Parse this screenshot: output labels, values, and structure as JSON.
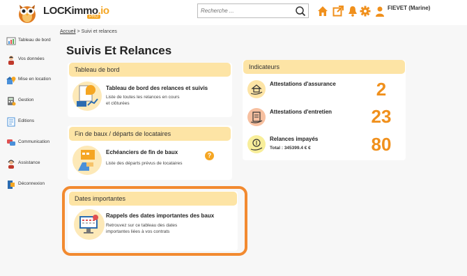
{
  "app": {
    "logo_text": "LOCKimmo",
    "logo_suffix": ".io",
    "logo_badge": "PRO"
  },
  "search": {
    "placeholder": "Recherche ..."
  },
  "user": {
    "name": "FIEVET (Marine)"
  },
  "top_icons": [
    "home-icon",
    "external-link-icon",
    "bell-icon",
    "gear-icon",
    "user-icon"
  ],
  "sidebar": {
    "items": [
      {
        "label": "Tableau de bord",
        "icon": "dashboard-icon"
      },
      {
        "label": "Vos données",
        "icon": "person-icon"
      },
      {
        "label": "Mise en location",
        "icon": "location-icon"
      },
      {
        "label": "Gestion",
        "icon": "calculator-icon"
      },
      {
        "label": "Editions",
        "icon": "document-icon"
      },
      {
        "label": "Communication",
        "icon": "chat-icon"
      },
      {
        "label": "Assistance",
        "icon": "headset-icon"
      },
      {
        "label": "Déconnexion",
        "icon": "logout-icon"
      }
    ]
  },
  "breadcrumb": {
    "home": "Accueil",
    "separator": ">",
    "current": "Suivi et relances"
  },
  "page": {
    "title": "Suivis Et Relances"
  },
  "sections": {
    "dashboard": {
      "heading": "Tableau de bord",
      "card_title": "Tableau de bord des relances et suivis",
      "card_desc_1": "Liste de toutes les relances en cours",
      "card_desc_2": "et clôturées"
    },
    "lease_end": {
      "heading": "Fin de baux / départs de locataires",
      "card_title": "Echéanciers de fin de baux",
      "card_desc": "Liste des départs prévus de locataires",
      "help": "?"
    },
    "important_dates": {
      "heading": "Dates importantes",
      "card_title": "Rappels des dates importantes des baux",
      "card_desc_1": "Retrouvez sur ce tableau des dates",
      "card_desc_2": "importantes liées à vos contrats"
    }
  },
  "indicators": {
    "heading": "Indicateurs",
    "items": [
      {
        "label": "Attestations d'assurance",
        "value": "2"
      },
      {
        "label": "Attestations d'entretien",
        "value": "23"
      },
      {
        "label": "Relances impayés",
        "value": "80",
        "sub": "Total : 345399.4 € €"
      }
    ]
  },
  "colors": {
    "accent": "#f0901c",
    "panel_header": "#fde4a5",
    "highlight_border": "#f28a30"
  }
}
